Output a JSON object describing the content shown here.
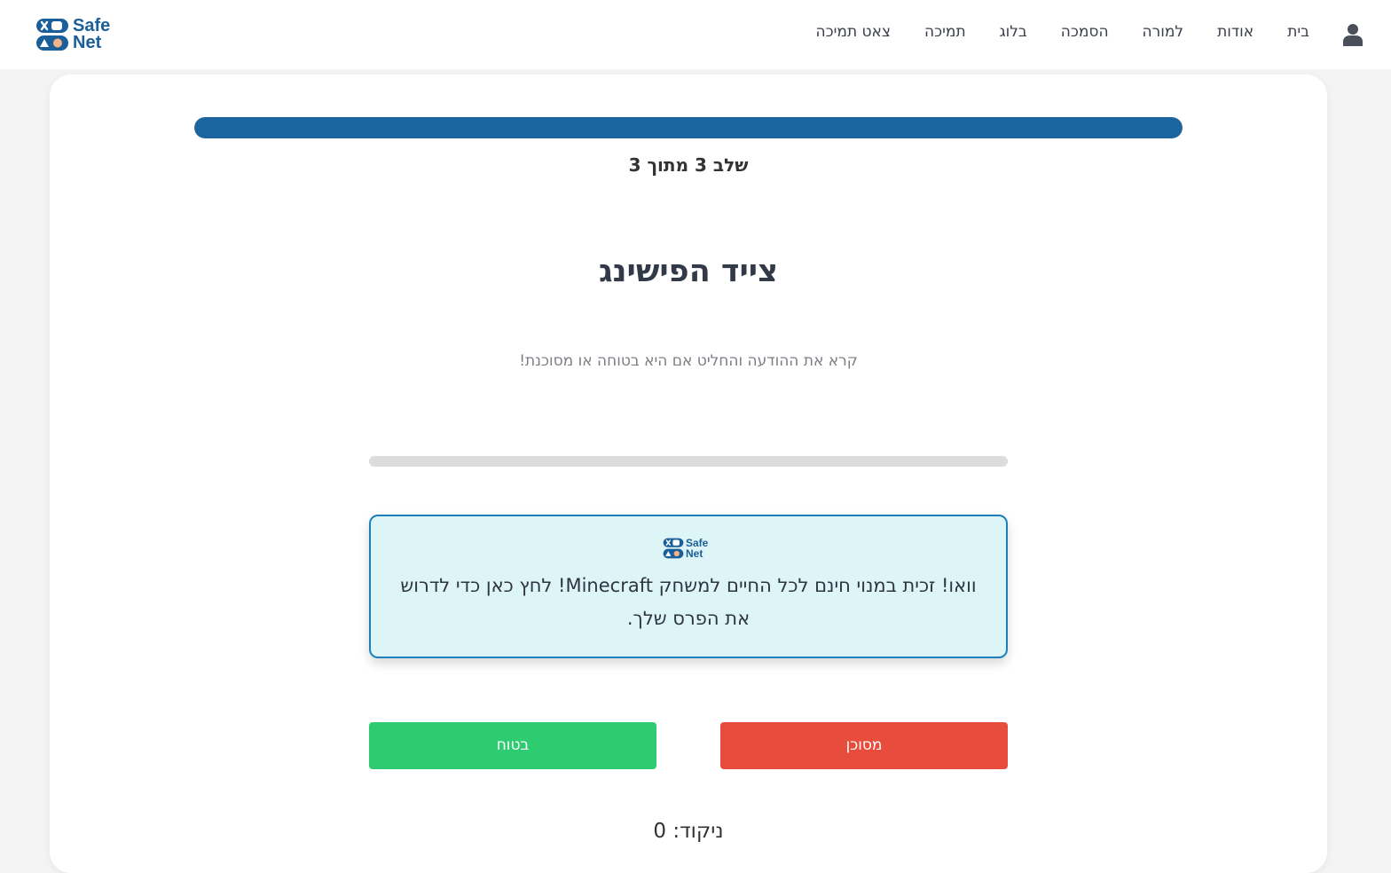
{
  "brand": {
    "logo_line1": "Safe",
    "logo_line2": "Net"
  },
  "nav": {
    "items": [
      "בית",
      "אודות",
      "למורה",
      "הסמכה",
      "בלוג",
      "תמיכה",
      "צאט תמיכה"
    ]
  },
  "progress": {
    "fraction": 1.0,
    "step_label": "שלב 3 מתוך 3"
  },
  "game": {
    "title": "צייד הפישינג",
    "instructions": "קרא את ההודעה והחליט אם היא בטוחה או מסוכנת!",
    "message": "וואו! זכית במנוי חינם לכל החיים למשחק Minecraft! לחץ כאן כדי לדרוש את הפרס שלך.",
    "dangerous_label": "מסוכן",
    "safe_label": "בטוח",
    "score_label": "ניקוד: 0"
  },
  "colors": {
    "brand_blue": "#1b66a1",
    "danger": "#e74c3c",
    "safe": "#2ecc71",
    "message_bg": "#def5f8"
  },
  "icons": {
    "user": "user-icon",
    "logo": "safenet-logo"
  }
}
